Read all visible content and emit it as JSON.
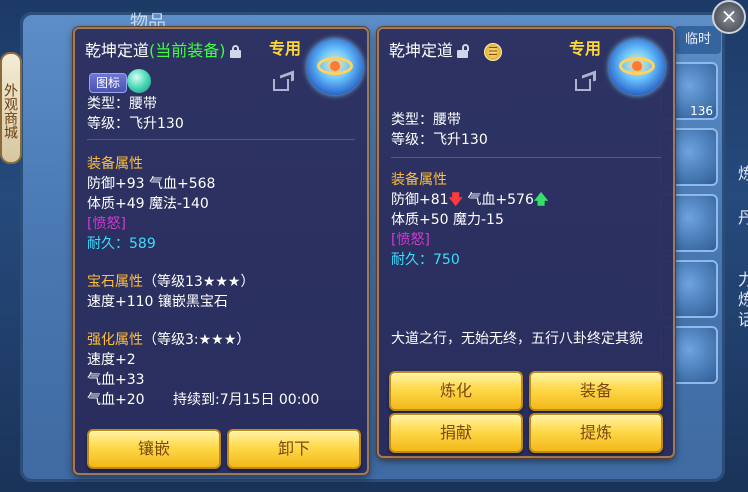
{
  "background": {
    "title": "物品",
    "side_tab": "外观商城",
    "temp_tab": "临时",
    "slot_count": "136",
    "right_edge": [
      "炼",
      "丹",
      "力",
      "炼",
      "话"
    ]
  },
  "left_card": {
    "name": "乾坤定道",
    "equipped_tag": "(当前装备)",
    "exclusive": "专用",
    "icon_badge": "图标",
    "type_line": "类型：腰带",
    "level_line": "等级：飞升130",
    "equip_attr_title": "装备属性",
    "attr1": "防御+93  气血+568",
    "attr2": "体质+49  魔法-140",
    "anger": "[愤怒]",
    "durability": "耐久：589",
    "gem_title": "宝石属性",
    "gem_level": "（等级13★★★）",
    "gem_line": "速度+110  镶嵌黑宝石",
    "enhance_title": "强化属性",
    "enhance_level": "（等级3:★★★）",
    "enhance1": "速度+2",
    "enhance2": "气血+33",
    "enhance3": "气血+20",
    "duration": "持续到:7月15日 00:00",
    "btn_inlay": "镶嵌",
    "btn_unequip": "卸下"
  },
  "right_card": {
    "name": "乾坤定道",
    "exclusive": "专用",
    "type_line": "类型：腰带",
    "level_line": "等级：飞升130",
    "equip_attr_title": "装备属性",
    "attr_def": "防御+81",
    "attr_hp": "气血+576",
    "attr2": "体质+50  魔力-15",
    "anger": "[愤怒]",
    "durability": "耐久：750",
    "desc": "大道之行，无始无终，五行八卦终定其貌",
    "btn_refine": "炼化",
    "btn_equip": "装备",
    "btn_donate": "捐献",
    "btn_extract": "提炼"
  }
}
